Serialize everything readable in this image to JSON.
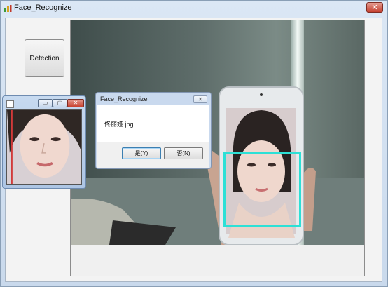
{
  "main_window": {
    "title": "Face_Recognize",
    "close_glyph": "✕",
    "detection_label": "Detection"
  },
  "face_window": {
    "minimize_glyph": "▭",
    "maximize_glyph": "▢",
    "close_glyph": "✕"
  },
  "dialog": {
    "title": "Face_Recognize",
    "close_glyph": "✕",
    "message": "佟丽娅.jpg",
    "yes_label": "是(Y)",
    "no_label": "否(N)"
  },
  "colors": {
    "detection_box": "#2de0d6",
    "face_window_marker": "#d23a3a"
  }
}
